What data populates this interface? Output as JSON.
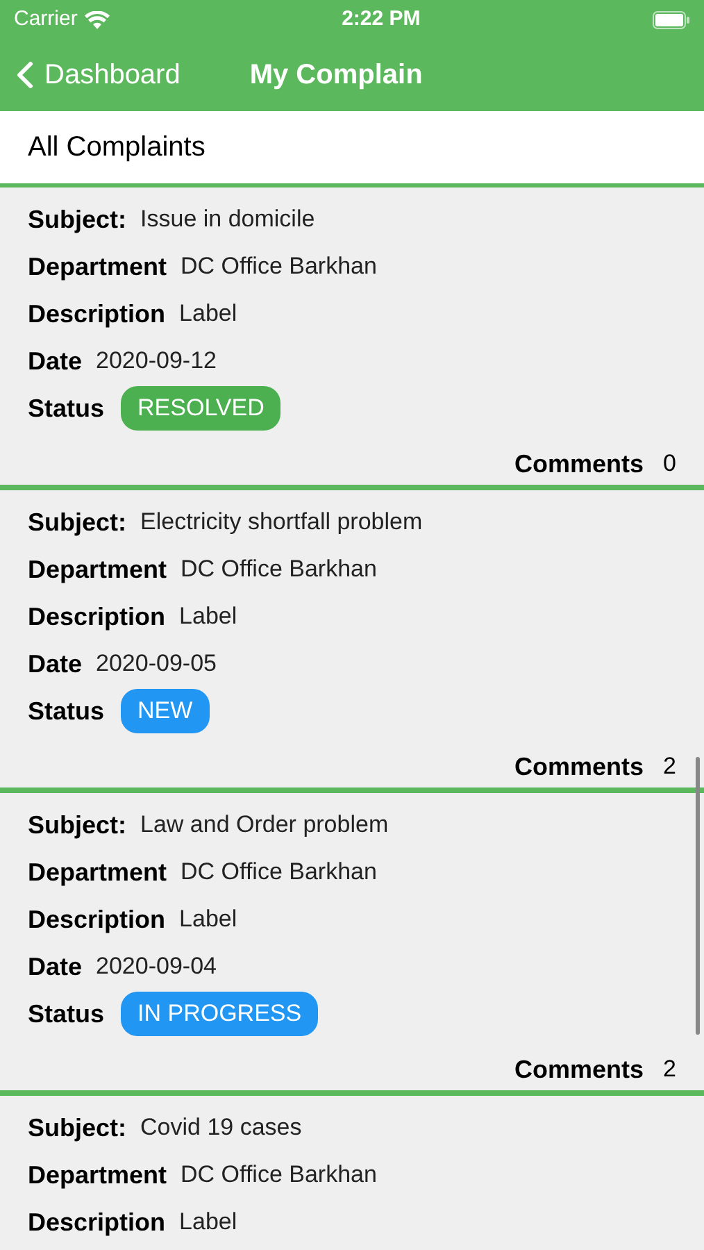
{
  "status_bar": {
    "carrier": "Carrier",
    "time": "2:22 PM"
  },
  "nav": {
    "back": "Dashboard",
    "title": "My Complain"
  },
  "section": {
    "title": "All Complaints"
  },
  "complaints": [
    {
      "fields": [
        {
          "label": "Subject:",
          "value": "Issue in domicile"
        },
        {
          "label": "Department",
          "value": "DC Office Barkhan"
        },
        {
          "label": "Description",
          "value": "Label"
        },
        {
          "label": "Date",
          "value": "2020-09-12"
        }
      ],
      "status": {
        "label": "Status",
        "text": "RESOLVED",
        "color": "#4caf50"
      },
      "comments": {
        "label": "Comments",
        "count": "0"
      }
    },
    {
      "fields": [
        {
          "label": "Subject:",
          "value": "Electricity shortfall problem"
        },
        {
          "label": "Department",
          "value": "DC Office Barkhan"
        },
        {
          "label": "Description",
          "value": "Label"
        },
        {
          "label": "Date",
          "value": "2020-09-05"
        }
      ],
      "status": {
        "label": "Status",
        "text": "NEW",
        "color": "#2196f3"
      },
      "comments": {
        "label": "Comments",
        "count": "2"
      }
    },
    {
      "fields": [
        {
          "label": "Subject:",
          "value": "Law and Order problem"
        },
        {
          "label": "Department",
          "value": "DC Office Barkhan"
        },
        {
          "label": "Description",
          "value": "Label"
        },
        {
          "label": "Date",
          "value": "2020-09-04"
        }
      ],
      "status": {
        "label": "Status",
        "text": "IN PROGRESS",
        "color": "#2196f3"
      },
      "comments": {
        "label": "Comments",
        "count": "2"
      }
    },
    {
      "fields": [
        {
          "label": "Subject:",
          "value": "Covid 19 cases"
        },
        {
          "label": "Department",
          "value": "DC Office Barkhan"
        },
        {
          "label": "Description",
          "value": "Label"
        }
      ]
    }
  ]
}
